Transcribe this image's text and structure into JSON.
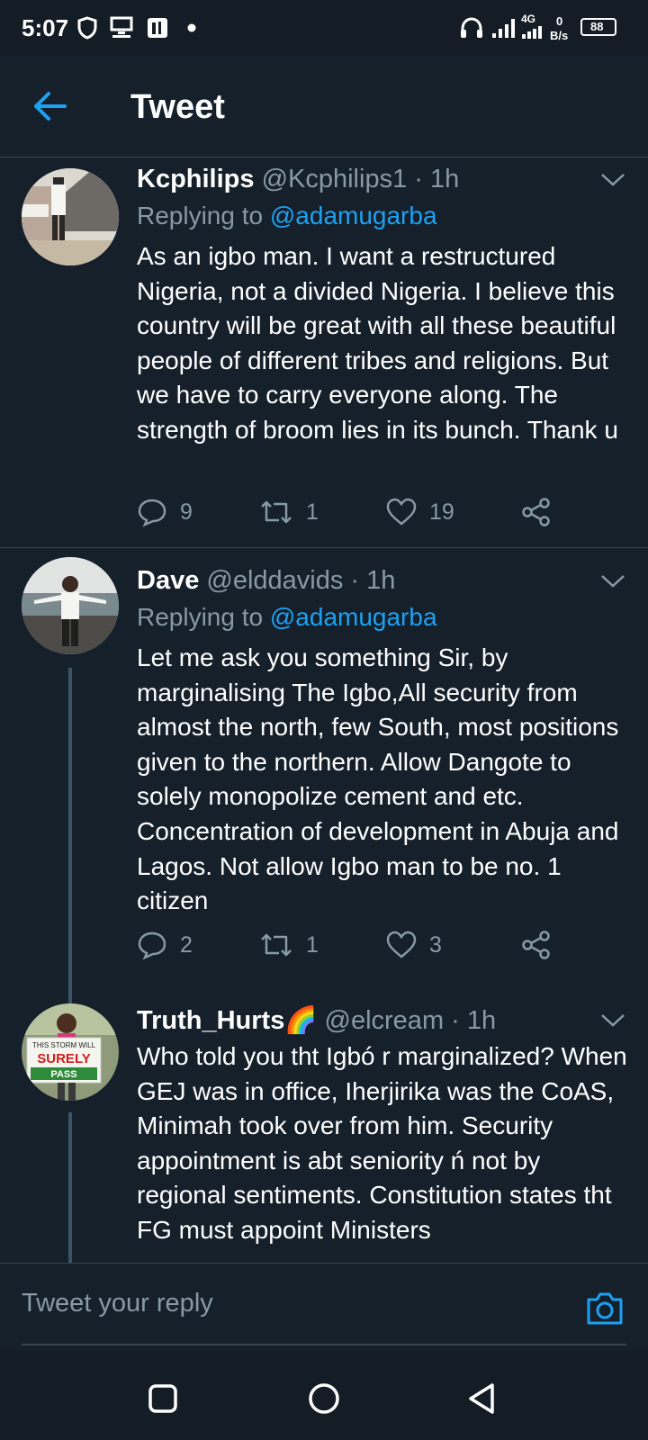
{
  "status_bar": {
    "time": "5:07",
    "network": "4G",
    "speed_value": "0",
    "speed_unit": "B/s",
    "battery": "88"
  },
  "header": {
    "title": "Tweet"
  },
  "tweets": [
    {
      "name": "Kcphilips",
      "emoji": "",
      "handle": "@Kcphilips1",
      "time": "1h",
      "replying_prefix": "Replying to ",
      "replying_to": "@adamugarba",
      "body": "As an igbo man. I want a restructured Nigeria, not a divided Nigeria. I believe this country will be great with all these beautiful people of different tribes and religions.  But we have to carry everyone along. The strength of broom lies in its bunch. Thank u",
      "replies": "9",
      "retweets": "1",
      "likes": "19"
    },
    {
      "name": "Dave",
      "emoji": "",
      "handle": "@elddavids",
      "time": "1h",
      "replying_prefix": "Replying to ",
      "replying_to": "@adamugarba",
      "body": "Let me ask you something Sir, by marginalising The Igbo,All security from almost the north, few South, most positions given to the northern. Allow Dangote to solely monopolize cement and etc. Concentration of development in Abuja and Lagos. Not allow Igbo man to be no. 1 citizen",
      "replies": "2",
      "retweets": "1",
      "likes": "3"
    },
    {
      "name": "Truth_Hurts",
      "emoji": "🌈",
      "handle": "@elcream",
      "time": "1h",
      "body": "Who told you tht Igbó r marginalized? When GEJ was in office, Iherjirika was the CoAS, Minimah took over from him. Security appointment is abt seniority ń not by regional sentiments. Constitution states tht FG must appoint Ministers",
      "avatar_sign": [
        "THIS STORM WILL",
        "SURELY",
        "PASS"
      ]
    }
  ],
  "composer": {
    "placeholder": "Tweet your reply"
  },
  "colors": {
    "background": "#15202b",
    "accent": "#1da1f2",
    "secondary_text": "#8899a6",
    "divider": "#38444d"
  },
  "icons": {
    "back": "arrow-left-icon",
    "caret": "chevron-down-icon",
    "reply": "speech-bubble-icon",
    "retweet": "retweet-icon",
    "like": "heart-icon",
    "share": "share-icon",
    "camera": "camera-icon"
  }
}
